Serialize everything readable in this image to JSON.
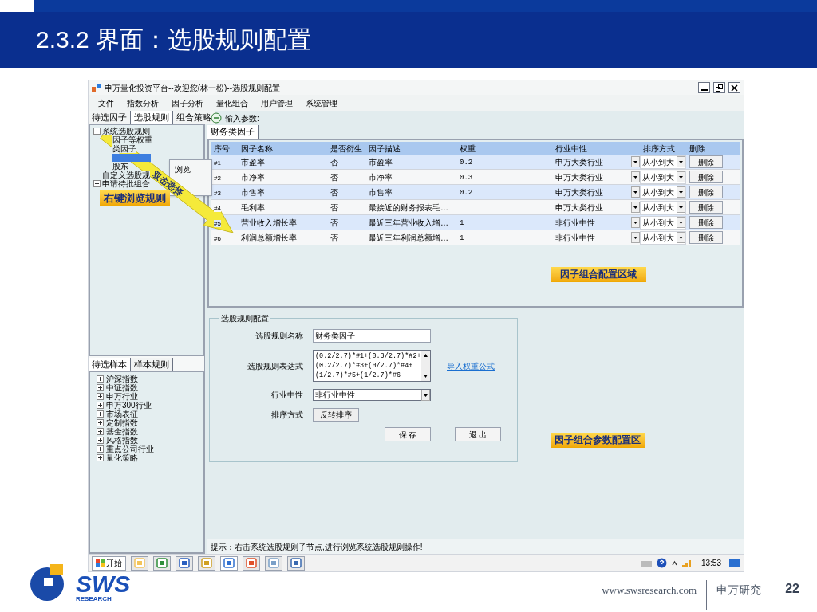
{
  "slide": {
    "title": "2.3.2 界面：选股规则配置",
    "logo_text": "SWS",
    "logo_subtext": "RESEARCH",
    "footer_url": "www.swsresearch.com",
    "footer_brand": "申万研究",
    "page_number": "22"
  },
  "window": {
    "title": "申万量化投资平台--欢迎您(林一松)--选股规则配置",
    "menu": [
      "文件",
      "指数分析",
      "因子分析",
      "量化组合",
      "用户管理",
      "系统管理"
    ]
  },
  "left_tabs": [
    {
      "label": "待选因子",
      "selected": false
    },
    {
      "label": "选股规则",
      "selected": true
    },
    {
      "label": "组合策略",
      "selected": false
    }
  ],
  "rule_tree": [
    {
      "label": "系统选股规则",
      "expanded": true,
      "children": [
        {
          "label": "因子等权重",
          "selected": false
        },
        {
          "label": "类因子",
          "selected": false
        },
        {
          "selected": true
        },
        {
          "label": "股东",
          "selected": false
        }
      ]
    },
    {
      "label": "自定义选股规"
    },
    {
      "label": "申请待批组合",
      "expanded": false
    }
  ],
  "context_menu": [
    "浏览"
  ],
  "sample_tabs": [
    {
      "label": "待选样本",
      "selected": true
    },
    {
      "label": "样本规则",
      "selected": false
    }
  ],
  "sample_tree": [
    {
      "label": "沪深指数",
      "expanded": false
    },
    {
      "label": "中证指数",
      "expanded": false
    },
    {
      "label": "申万行业",
      "expanded": false
    },
    {
      "label": "申万300行业",
      "expanded": false
    },
    {
      "label": "市场表征",
      "expanded": false
    },
    {
      "label": "定制指数",
      "expanded": false
    },
    {
      "label": "基金指数",
      "expanded": false
    },
    {
      "label": "风格指数",
      "expanded": false
    },
    {
      "label": "重点公司行业",
      "expanded": false
    },
    {
      "label": "量化策略",
      "expanded": false
    }
  ],
  "params_label": "输入参数:",
  "factor_tabs": [
    {
      "label": "财务类因子",
      "selected": true
    }
  ],
  "table": {
    "columns": [
      "序号",
      "因子名称",
      "是否衍生",
      "因子描述",
      "权重",
      "行业中性",
      "排序方式",
      "删除"
    ],
    "rows": [
      {
        "index": "#1",
        "name": "市盈率",
        "derived": "否",
        "description": "市盈率",
        "weight": "0.2",
        "industry": "申万大类行业",
        "sort": "从小到大",
        "action": "删除"
      },
      {
        "index": "#2",
        "name": "市净率",
        "derived": "否",
        "description": "市净率",
        "weight": "0.3",
        "industry": "申万大类行业",
        "sort": "从小到大",
        "action": "删除"
      },
      {
        "index": "#3",
        "name": "市售率",
        "derived": "否",
        "description": "市售率",
        "weight": "0.2",
        "industry": "申万大类行业",
        "sort": "从小到大",
        "action": "删除"
      },
      {
        "index": "#4",
        "name": "毛利率",
        "derived": "否",
        "description": "最接近的财务报表毛…",
        "industry": "申万大类行业",
        "sort": "从小到大",
        "action": "删除"
      },
      {
        "index": "#5",
        "name": "营业收入增长率",
        "derived": "否",
        "description": "最近三年营业收入增…",
        "weight": "1",
        "industry": "非行业中性",
        "sort": "从小到大",
        "action": "删除"
      },
      {
        "index": "#6",
        "name": "利润总额增长率",
        "derived": "否",
        "description": "最近三年利润总额增…",
        "weight": "1",
        "industry": "非行业中性",
        "sort": "从小到大",
        "action": "删除"
      }
    ]
  },
  "rule_config": {
    "title": "选股规则配置",
    "fields": [
      {
        "kind": "text",
        "label": "选股规则名称",
        "value": "财务类因子"
      },
      {
        "kind": "textarea",
        "label": "选股规则表达式",
        "lines": [
          "(0.2/2.7)*#1+(0.3/2.7)*#2+",
          "(0.2/2.7)*#3+(0/2.7)*#4+",
          "(1/2.7)*#5+(1/2.7)*#6"
        ],
        "link": "导入权重公式"
      },
      {
        "kind": "select",
        "label": "行业中性",
        "value": "非行业中性"
      },
      {
        "kind": "button",
        "label": "排序方式",
        "button": "反转排序"
      }
    ],
    "buttons": [
      "保 存",
      "退 出"
    ]
  },
  "annotations": {
    "browse": "右键浏览规则",
    "double_click": "双击选择",
    "table_area": "因子组合配置区域",
    "params_area": "因子组合参数配置区"
  },
  "hint": "提示：右击系统选股规则子节点,进行浏览系统选股规则操作!",
  "taskbar": {
    "start": "开始",
    "clock": "13:53"
  }
}
